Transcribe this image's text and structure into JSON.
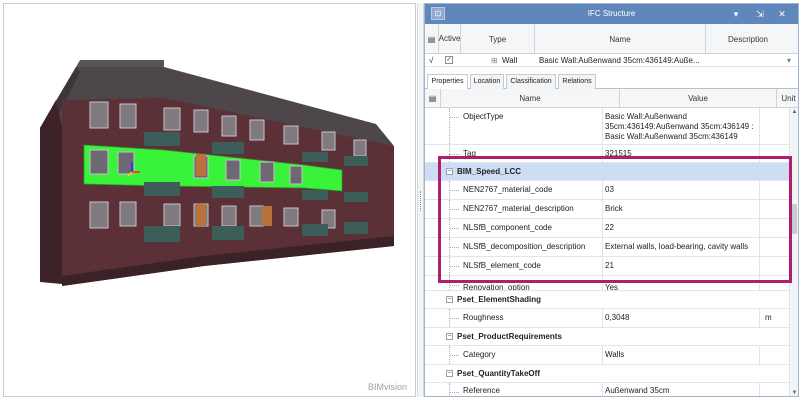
{
  "viewport": {
    "brand": "BIMvision",
    "colors": {
      "brick": "#5b3036",
      "roof": "#4a4347",
      "selection": "#39f33a",
      "balcony": "#3d5e58"
    }
  },
  "ifc_panel": {
    "title": "IFC Structure",
    "icons": [
      "pin-icon",
      "dropdown-icon",
      "dock-icon",
      "close-icon"
    ],
    "tree": {
      "headers": {
        "active": "Active",
        "type": "Type",
        "name": "Name",
        "description": "Description"
      },
      "rows": [
        {
          "check": "√",
          "type": "Wall",
          "name": "Basic Wall:Außenwand 35cm:436149:Auße..."
        }
      ]
    },
    "tabs": [
      "Properties",
      "Location",
      "Classification",
      "Relations"
    ],
    "active_tab": "Properties",
    "props_headers": {
      "name": "Name",
      "value": "Value",
      "unit": "Unit"
    },
    "rows": {
      "objecttype": {
        "name": "ObjectType",
        "value": "Basic Wall:Außenwand 35cm:436149:Außenwand 35cm:436149 : Basic Wall:Außenwand 35cm:436149"
      },
      "tag": {
        "name": "Tag",
        "value": "321515"
      },
      "group_bim": "BIM_Speed_LCC",
      "material_code": {
        "name": "NEN2767_material_code",
        "value": "03"
      },
      "material_desc": {
        "name": "NEN2767_material_description",
        "value": "Brick"
      },
      "component_code": {
        "name": "NLSfB_component_code",
        "value": "22"
      },
      "decomp_desc": {
        "name": "NLSfB_decomposition_description",
        "value": "External walls, load-bearing, cavity walls"
      },
      "element_code": {
        "name": "NLSfB_element_code",
        "value": "21"
      },
      "renovation": {
        "name": "Renovation_option",
        "value": "Yes"
      },
      "group_shading": "Pset_ElementShading",
      "roughness": {
        "name": "Roughness",
        "value": "0,3048",
        "unit": "m"
      },
      "group_product": "Pset_ProductRequirements",
      "category": {
        "name": "Category",
        "value": "Walls"
      },
      "group_qto": "Pset_QuantityTakeOff",
      "reference": {
        "name": "Reference",
        "value": "Außenwand 35cm"
      }
    }
  }
}
